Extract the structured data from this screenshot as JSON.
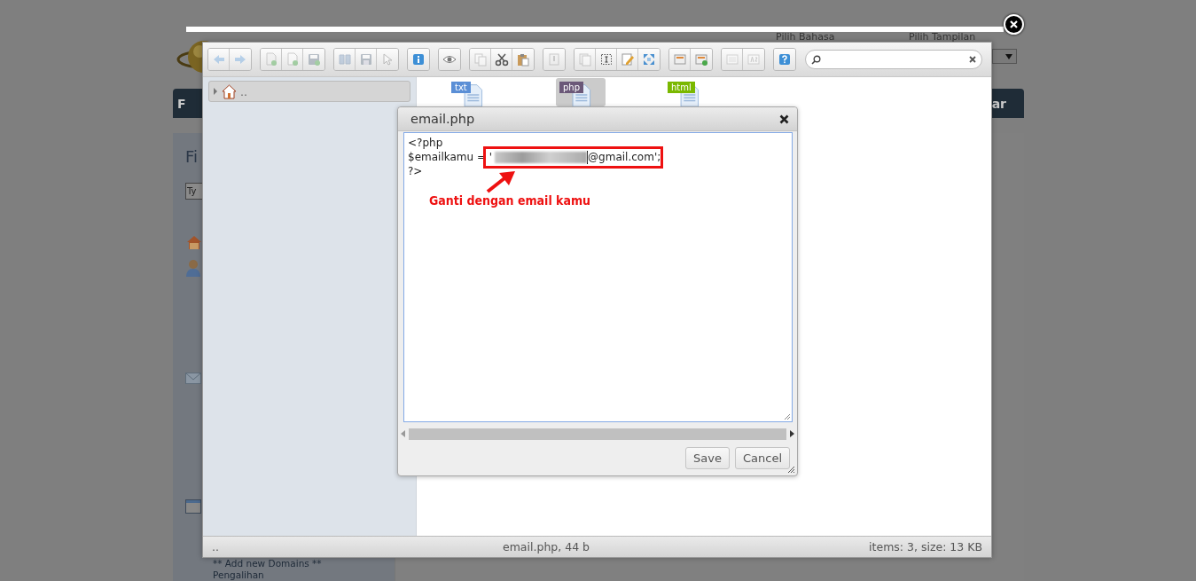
{
  "background_page": {
    "top_labels": [
      "Pilih Bahasa",
      "Pilih Tampilan"
    ],
    "nav_left": "F",
    "nav_right": "ar",
    "sidebar_heading": "Fi",
    "search": {
      "placeholder": "Ty"
    },
    "links": [
      "** Add new Domains **",
      "Pengalihan"
    ]
  },
  "file_manager": {
    "toolbar": [
      {
        "buttons": [
          {
            "kind": "back",
            "disabled": true
          },
          {
            "kind": "forward",
            "disabled": true
          }
        ]
      },
      {
        "buttons": [
          {
            "kind": "mkdir",
            "disabled": true
          },
          {
            "kind": "mkfile",
            "disabled": true
          },
          {
            "kind": "upload",
            "disabled": true
          }
        ]
      },
      {
        "buttons": [
          {
            "kind": "open",
            "disabled": true
          },
          {
            "kind": "download",
            "disabled": true
          },
          {
            "kind": "select",
            "disabled": true
          }
        ]
      },
      {
        "buttons": [
          {
            "kind": "info",
            "disabled": false
          }
        ]
      },
      {
        "buttons": [
          {
            "kind": "view",
            "disabled": false
          }
        ]
      },
      {
        "buttons": [
          {
            "kind": "copy",
            "disabled": true
          },
          {
            "kind": "cut",
            "disabled": false
          },
          {
            "kind": "paste",
            "disabled": false
          }
        ]
      },
      {
        "buttons": [
          {
            "kind": "remove",
            "disabled": true
          }
        ]
      },
      {
        "buttons": [
          {
            "kind": "duplicate",
            "disabled": true
          },
          {
            "kind": "rename",
            "disabled": false
          },
          {
            "kind": "edit",
            "disabled": false
          },
          {
            "kind": "resize",
            "disabled": false
          }
        ]
      },
      {
        "buttons": [
          {
            "kind": "extract",
            "disabled": false
          },
          {
            "kind": "compress",
            "disabled": false
          }
        ]
      },
      {
        "buttons": [
          {
            "kind": "list",
            "disabled": true
          },
          {
            "kind": "sort",
            "disabled": true
          }
        ]
      },
      {
        "buttons": [
          {
            "kind": "help",
            "disabled": false
          }
        ]
      }
    ],
    "tree": [
      {
        "label": "..",
        "expanded": false
      }
    ],
    "files": [
      {
        "badge": "txt",
        "color": "#5b8fd6",
        "selected": false
      },
      {
        "badge": "php",
        "color": "#6b5878",
        "selected": true
      },
      {
        "badge": "html",
        "color": "#7ab800",
        "selected": false
      }
    ],
    "status_bar": {
      "path": "..",
      "selection": "email.php, 44 b",
      "summary": "items: 3, size: 13 KB"
    }
  },
  "editor_dialog": {
    "title": "email.php",
    "lines": [
      {
        "text": "<?php"
      },
      {
        "prefix": "$emailkamu = '",
        "redacted": true,
        "suffix": "@gmail.com';"
      },
      {
        "text": "?>"
      }
    ],
    "annotation": {
      "text": "Ganti dengan email kamu"
    },
    "buttons": [
      "Save",
      "Cancel"
    ]
  }
}
